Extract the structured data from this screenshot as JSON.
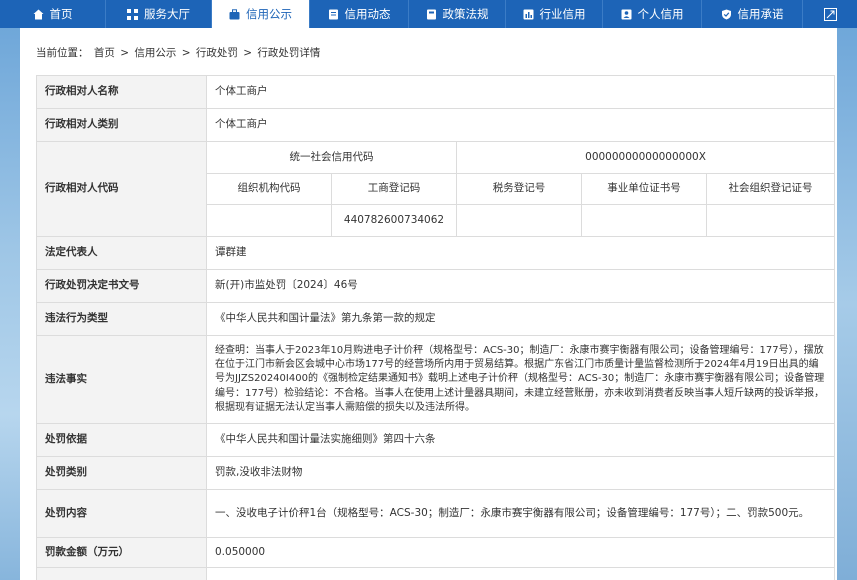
{
  "nav": {
    "items": [
      {
        "label": "首页",
        "icon": "home-icon",
        "active": false
      },
      {
        "label": "服务大厅",
        "icon": "grid-icon",
        "active": false
      },
      {
        "label": "信用公示",
        "icon": "briefcase-icon",
        "active": true
      },
      {
        "label": "信用动态",
        "icon": "document-icon",
        "active": false
      },
      {
        "label": "政策法规",
        "icon": "book-icon",
        "active": false
      },
      {
        "label": "行业信用",
        "icon": "bar-chart-icon",
        "active": false
      },
      {
        "label": "个人信用",
        "icon": "id-card-icon",
        "active": false
      },
      {
        "label": "信用承诺",
        "icon": "shield-icon",
        "active": false
      }
    ]
  },
  "breadcrumb": {
    "prefix": "当前位置：",
    "items": [
      "首页",
      "信用公示",
      "行政处罚",
      "行政处罚详情"
    ],
    "separator": ">"
  },
  "detail": {
    "name_label": "行政相对人名称",
    "name_value": "个体工商户",
    "type_label": "行政相对人类别",
    "type_value": "个体工商户",
    "code_label": "行政相对人代码",
    "uscc_label": "统一社会信用代码",
    "uscc_value": "00000000000000000X",
    "org_code_label": "组织机构代码",
    "biz_reg_label": "工商登记码",
    "tax_reg_label": "税务登记号",
    "inst_cert_label": "事业单位证书号",
    "social_org_label": "社会组织登记证号",
    "org_code_value": "",
    "biz_reg_value": "440782600734062",
    "tax_reg_value": "",
    "inst_cert_value": "",
    "social_org_value": "",
    "legal_rep_label": "法定代表人",
    "legal_rep_value": "谭群建",
    "doc_no_label": "行政处罚决定书文号",
    "doc_no_value": "新(开)市监处罚〔2024〕46号",
    "violation_type_label": "违法行为类型",
    "violation_type_value": "《中华人民共和国计量法》第九条第一款的规定",
    "facts_label": "违法事实",
    "facts_value": "经查明：当事人于2023年10月购进电子计价秤（规格型号：ACS-30；制造厂：永康市赛宇衡器有限公司；设备管理编号：177号），摆放在位于江门市新会区会城中心市场177号的经营场所内用于贸易结算。根据广东省江门市质量计量监督检测所于2024年4月19日出具的编号为JJZS20240I400的《强制检定结果通知书》载明上述电子计价秤（规格型号：ACS-30；制造厂：永康市赛宇衡器有限公司；设备管理编号：177号）检验结论：不合格。当事人在使用上述计量器具期间，未建立经营账册，亦未收到消费者反映当事人短斤缺两的投诉举报，根据现有证据无法认定当事人需赔偿的损失以及违法所得。",
    "basis_label": "处罚依据",
    "basis_value": "《中华人民共和国计量法实施细则》第四十六条",
    "category_label": "处罚类别",
    "category_value": "罚款,没收非法财物",
    "content_label": "处罚内容",
    "content_value": "一、没收电子计价秤1台（规格型号：ACS-30；制造厂：永康市赛宇衡器有限公司；设备管理编号：177号）；二、罚款500元。",
    "fine_label": "罚款金额（万元）",
    "fine_value": "0.050000"
  }
}
